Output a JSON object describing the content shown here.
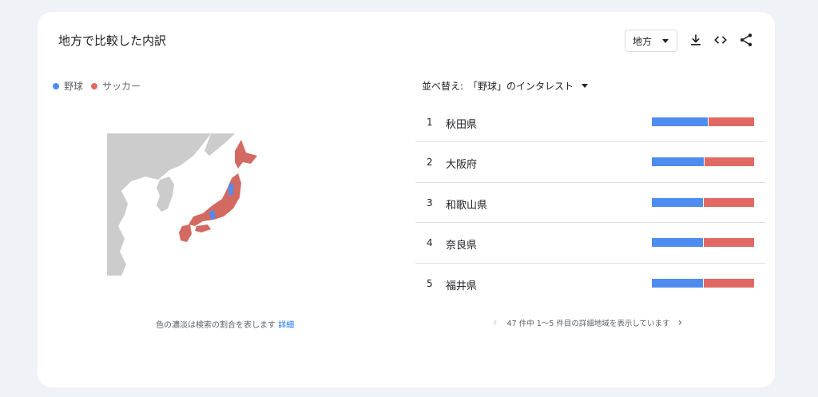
{
  "card": {
    "title": "地方で比較した内訳",
    "geo_select": "地方",
    "icons": [
      "download-icon",
      "embed-code-icon",
      "share-icon"
    ]
  },
  "legend": [
    {
      "label": "野球",
      "color": "#4f8cf0"
    },
    {
      "label": "サッカー",
      "color": "#e06a63"
    }
  ],
  "map": {
    "note": "色の濃淡は検索の割合を表します",
    "note_link": "詳細"
  },
  "sort": {
    "prefix": "並べ替え:",
    "value": "「野球」のインタレスト"
  },
  "rows": [
    {
      "rank": "1",
      "name": "秋田県",
      "share": 0.55
    },
    {
      "rank": "2",
      "name": "大阪府",
      "share": 0.51
    },
    {
      "rank": "3",
      "name": "和歌山県",
      "share": 0.5
    },
    {
      "rank": "4",
      "name": "奈良県",
      "share": 0.5
    },
    {
      "rank": "5",
      "name": "福井県",
      "share": 0.5
    }
  ],
  "pager": {
    "text": "47 件中 1〜5 件目の詳細地域を表示しています"
  }
}
